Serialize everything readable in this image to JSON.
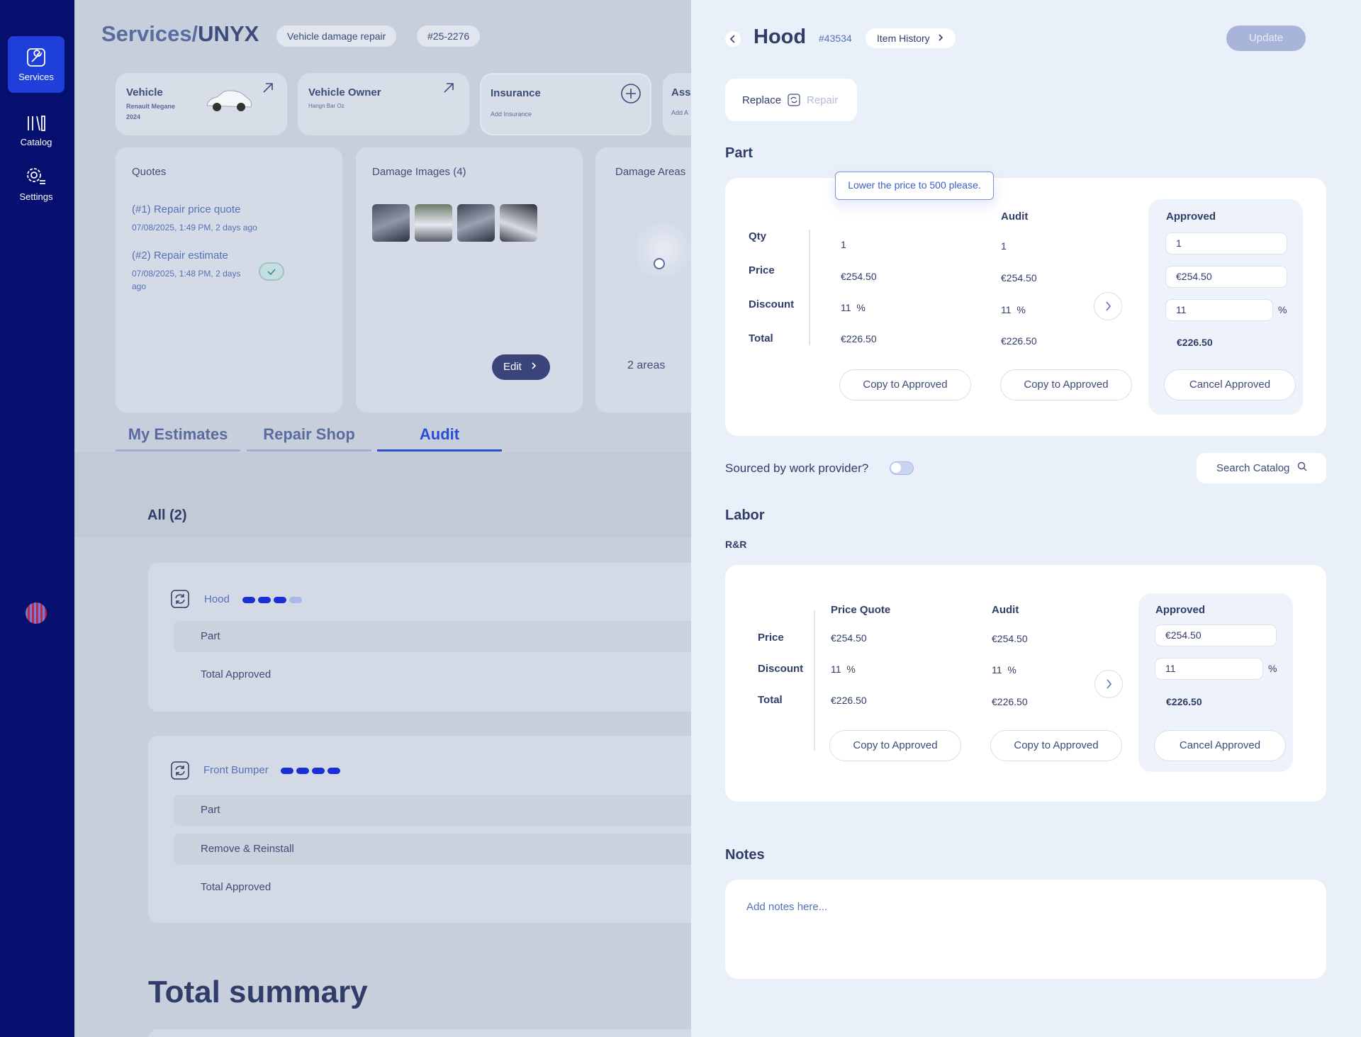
{
  "sidebar": {
    "items": [
      {
        "label": "Services",
        "icon": "wrench-icon"
      },
      {
        "label": "Catalog",
        "icon": "catalog-icon"
      },
      {
        "label": "Settings",
        "icon": "gear-icon"
      }
    ]
  },
  "header": {
    "breadcrumb_parent": "Services/",
    "breadcrumb_current": "UNYX",
    "chip_service": "Vehicle damage repair",
    "chip_id": "#25-2276"
  },
  "info_cards": {
    "vehicle": {
      "title": "Vehicle",
      "sub1": "Renault Megane",
      "sub2": "2024"
    },
    "owner": {
      "title": "Vehicle Owner",
      "sub": "Hangn Bar Oz"
    },
    "insurance": {
      "title": "Insurance",
      "sub": "Add Insurance"
    },
    "assessor": {
      "title": "Ass",
      "sub": "Add A"
    }
  },
  "quotes": {
    "title": "Quotes",
    "items": [
      {
        "name": "(#1) Repair price quote",
        "date": "07/08/2025, 1:49 PM, 2 days ago"
      },
      {
        "name": "(#2) Repair estimate",
        "date_line1": "07/08/2025, 1:48 PM, 2 days",
        "date_line2": "ago"
      }
    ]
  },
  "damage_images": {
    "title": "Damage Images (4)",
    "edit_label": "Edit"
  },
  "damage_areas": {
    "title": "Damage Areas",
    "count": "2 areas"
  },
  "tabs": [
    "My Estimates",
    "Repair Shop",
    "Audit"
  ],
  "list": {
    "filter_label": "All (2)",
    "items": [
      {
        "name": "Hood",
        "rows": [
          "Part",
          "Total Approved"
        ],
        "progress_filled": 3,
        "progress_total": 4
      },
      {
        "name": "Front Bumper",
        "rows": [
          "Part",
          "Remove & Reinstall",
          "Total Approved"
        ],
        "progress_filled": 4,
        "progress_total": 4
      }
    ],
    "summary_title": "Total summary"
  },
  "drawer": {
    "title": "Hood",
    "item_id": "#43534",
    "history_label": "Item History",
    "update_label": "Update",
    "mode_replace": "Replace",
    "mode_repair": "Repair",
    "part": {
      "section_title": "Part",
      "tooltip": "Lower the price to 500 please.",
      "row_labels": [
        "Qty",
        "Price",
        "Discount",
        "Total"
      ],
      "audit_header": "Audit",
      "approved_header": "Approved",
      "quote_values": {
        "qty": "1",
        "price": "€254.50",
        "discount": "11",
        "total": "€226.50"
      },
      "audit_values": {
        "qty": "1",
        "price": "€254.50",
        "discount": "11",
        "total": "€226.50"
      },
      "approved_values": {
        "qty": "1",
        "price": "€254.50",
        "discount": "11",
        "total": "€226.50"
      },
      "percent": "%",
      "copy_label": "Copy to Approved",
      "cancel_label": "Cancel Approved"
    },
    "sourced_label": "Sourced by work provider?",
    "search_catalog_label": "Search Catalog",
    "labor": {
      "section_title": "Labor",
      "subsection": "R&R",
      "row_labels": [
        "Price",
        "Discount",
        "Total"
      ],
      "quote_header": "Price Quote",
      "audit_header": "Audit",
      "approved_header": "Approved",
      "quote_values": {
        "price": "€254.50",
        "discount": "11",
        "total": "€226.50"
      },
      "audit_values": {
        "price": "€254.50",
        "discount": "11",
        "total": "€226.50"
      },
      "approved_values": {
        "price": "€254.50",
        "discount": "11",
        "total": "€226.50"
      },
      "percent": "%",
      "copy_label": "Copy to Approved",
      "cancel_label": "Cancel Approved"
    },
    "notes": {
      "title": "Notes",
      "placeholder": "Add notes here..."
    }
  },
  "colors": {
    "sidebar": "#050f6e",
    "accent": "#1e3fd9",
    "drawer_bg": "#eaf0f9"
  }
}
